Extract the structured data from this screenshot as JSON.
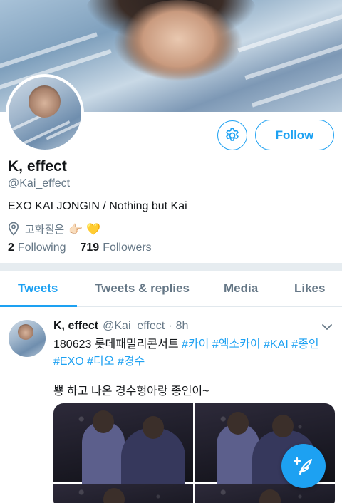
{
  "profile": {
    "display_name": "K, effect",
    "handle": "@Kai_effect",
    "bio": "EXO KAI JONGIN / Nothing but Kai",
    "location_text": "고화질은",
    "location_emoji": "👉🏻 💛",
    "following_count": "2",
    "following_label": "Following",
    "followers_count": "719",
    "followers_label": "Followers"
  },
  "buttons": {
    "follow_label": "Follow",
    "settings_icon": "gear-icon"
  },
  "tabs": [
    {
      "label": "Tweets",
      "active": true
    },
    {
      "label": "Tweets & replies",
      "active": false
    },
    {
      "label": "Media",
      "active": false
    },
    {
      "label": "Likes",
      "active": false
    }
  ],
  "tweet": {
    "name": "K, effect",
    "handle": "@Kai_effect",
    "dot": "·",
    "time": "8h",
    "line1_plain": "180623 롯데패밀리콘서트 ",
    "hashtags_line1": [
      "#카이",
      "#엑소카이",
      "#KAI",
      "#종인"
    ],
    "hashtags_line2": [
      "#EXO",
      "#디오",
      "#경수"
    ],
    "text2": "뿅 하고 나온 경수형아랑 종인이~",
    "media_count": 4
  },
  "colors": {
    "accent": "#1da1f2",
    "secondary_text": "#657786",
    "primary_text": "#14171a",
    "separator": "#e6ecf0"
  }
}
